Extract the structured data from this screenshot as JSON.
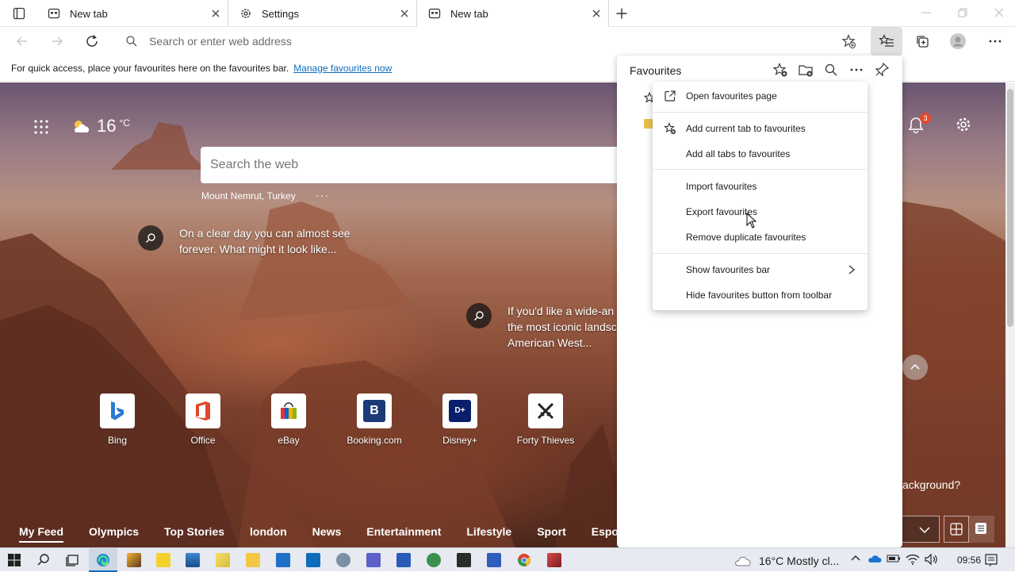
{
  "tabs": [
    {
      "label": "New tab",
      "icon": "newtab-icon"
    },
    {
      "label": "Settings",
      "icon": "gear-icon"
    },
    {
      "label": "New tab",
      "icon": "newtab-icon"
    }
  ],
  "address_bar": {
    "placeholder": "Search or enter web address"
  },
  "favbar": {
    "message": "For quick access, place your favourites here on the favourites bar.",
    "link": "Manage favourites now"
  },
  "newtab": {
    "weather": {
      "temp": "16",
      "unit": "°C"
    },
    "search_placeholder": "Search the web",
    "location": "Mount Nemrut, Turkey",
    "location_more": "···",
    "hotspot1": "On a clear day you can almost see forever. What might it look like...",
    "hotspot2_line1": "If you'd like a wide-an",
    "hotspot2_line2": "the most iconic landsc",
    "hotspot2_line3": "American West...",
    "notification_count": "3",
    "quick_links": [
      {
        "label": "Bing",
        "glyph": "b"
      },
      {
        "label": "Office",
        "glyph": "O"
      },
      {
        "label": "eBay",
        "glyph": "e"
      },
      {
        "label": "Booking.com",
        "glyph": "B"
      },
      {
        "label": "Disney+",
        "glyph": "D+"
      },
      {
        "label": "Forty Thieves",
        "glyph": "✕"
      }
    ],
    "background_prompt": "ackground?",
    "feed_tabs": [
      "My Feed",
      "Olympics",
      "Top Stories",
      "london",
      "News",
      "Entertainment",
      "Lifestyle",
      "Sport",
      "Esports"
    ],
    "feed_partial": "e"
  },
  "favourites_panel": {
    "title": "Favourites"
  },
  "context_menu": {
    "items": [
      "Open favourites page",
      "Add current tab to favourites",
      "Add all tabs to favourites",
      "Import favourites",
      "Export favourites",
      "Remove duplicate favourites",
      "Show favourites bar",
      "Hide favourites button from toolbar"
    ]
  },
  "taskbar": {
    "weather": "16°C Mostly cl...",
    "time": "09:56"
  },
  "colors": {
    "accent": "#0f6cbd",
    "taskbar": "#e7eaf1",
    "badge": "#e5482d"
  }
}
